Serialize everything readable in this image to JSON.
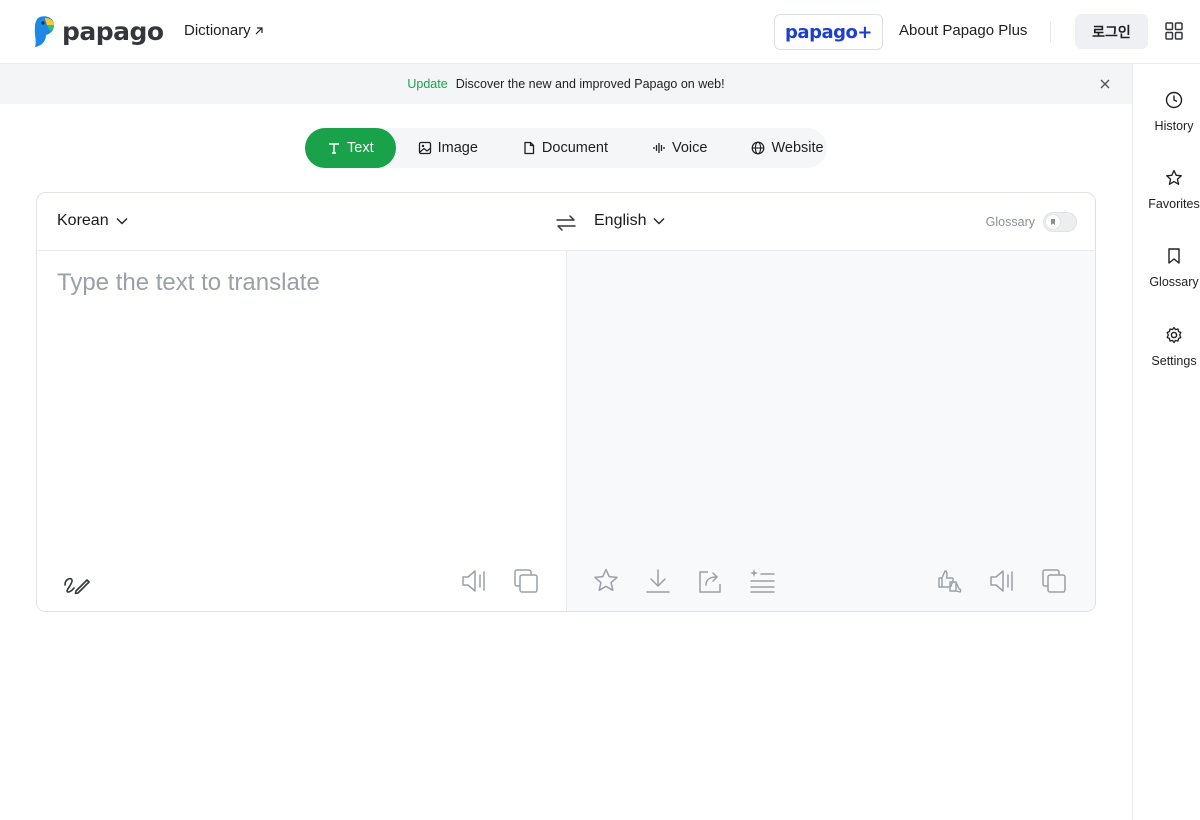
{
  "header": {
    "logo_text": "papago",
    "dictionary_link": "Dictionary",
    "plus_brand": "papago+",
    "about_link": "About Papago Plus",
    "login_label": "로그인"
  },
  "banner": {
    "tag": "Update",
    "message": "Discover the new and improved Papago on web!"
  },
  "tabs": [
    {
      "label": "Text",
      "icon": "text-icon",
      "active": true
    },
    {
      "label": "Image",
      "icon": "image-icon",
      "active": false
    },
    {
      "label": "Document",
      "icon": "document-icon",
      "active": false
    },
    {
      "label": "Voice",
      "icon": "voice-icon",
      "active": false
    },
    {
      "label": "Website",
      "icon": "globe-icon",
      "active": false
    }
  ],
  "translator": {
    "source_language": "Korean",
    "target_language": "English",
    "glossary_label": "Glossary",
    "glossary_enabled": false,
    "source_placeholder": "Type the text to translate",
    "source_value": ""
  },
  "sidebar": {
    "items": [
      {
        "label": "History",
        "icon": "clock-icon"
      },
      {
        "label": "Favorites",
        "icon": "star-icon"
      },
      {
        "label": "Glossary",
        "icon": "bookmark-icon"
      },
      {
        "label": "Settings",
        "icon": "gear-icon"
      }
    ]
  },
  "colors": {
    "accent_green": "#19a249",
    "brand_blue": "#1d3fce"
  }
}
